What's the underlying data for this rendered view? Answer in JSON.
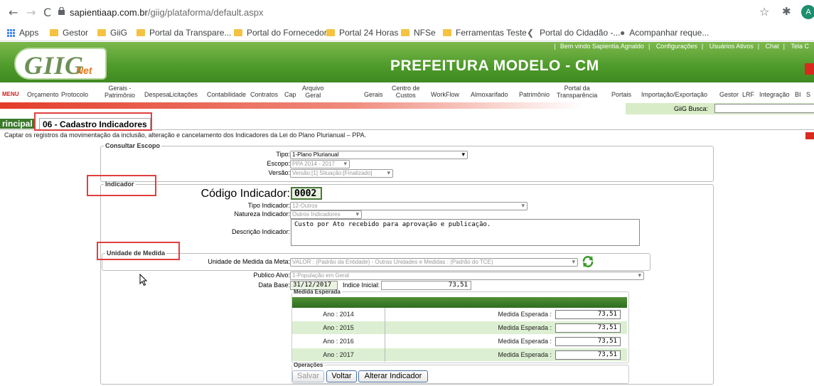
{
  "browser": {
    "url_host": "sapientiaap.com.br",
    "url_path": "/giig/plataforma/default.aspx",
    "avatar_initial": "A",
    "bookmarks": [
      "Apps",
      "Gestor",
      "GiiG",
      "Portal da Transpare...",
      "Portal do Fornecedor",
      "Portal 24 Horas",
      "NFSe",
      "Ferramentas Teste",
      "Portal do Cidadão -...",
      "Acompanhar reque..."
    ]
  },
  "header": {
    "logo_text": "GIIG",
    "logo_sub": "Net",
    "title": "PREFEITURA MODELO - CM",
    "links": [
      "Bem vindo Sapientia.Agnaldo",
      "Configurações",
      "Usuários Ativos",
      "Chat",
      "Tela C"
    ]
  },
  "menu": {
    "label": "MENU",
    "items": [
      "Orçamento",
      "Protocolo",
      "Despesa",
      "Licitações",
      "Contabilidade",
      "Contratos",
      "Cap",
      "Gerais",
      "WorkFlow",
      "Almoxarifado",
      "Patrimônio",
      "Portais",
      "Importação/Exportação",
      "Gestor",
      "LRF",
      "Integração",
      "BI",
      "S"
    ],
    "gerais_patrimonio": [
      "Gerais -",
      "Patrimônio"
    ],
    "arquivo_geral": [
      "Arquivo",
      "Geral"
    ],
    "centro_custos": [
      "Centro de",
      "Custos"
    ],
    "portal_transparencia": [
      "Portal da",
      "Transparência"
    ],
    "busca_label": "GiiG Busca:"
  },
  "tabs": {
    "principal": "rincipal",
    "active": "06 - Cadastro Indicadores"
  },
  "description": "Captar os registros da movimentação da inclusão, alteração e cancelamento dos Indicadores da Lei do Plano Plurianual – PPA.",
  "consultar": {
    "legend": "Consultar Escopo",
    "tipo_label": "Tipo:",
    "tipo_value": "1-Plano Plurianual",
    "escopo_label": "Escopo:",
    "escopo_value": "PPA 2014 - 2017",
    "versao_label": "Versão:",
    "versao_value": "Versão:[1] Situação:[Finalizado]"
  },
  "indicador": {
    "legend": "Indicador",
    "codigo_label": "Código Indicador:",
    "codigo_value": "0002",
    "tipo_label": "Tipo Indicador:",
    "tipo_value": "12-Outros",
    "natureza_label": "Natureza Indicador:",
    "natureza_value": "Outros Indicadores",
    "descricao_label": "Descrição Indicador:",
    "descricao_value": "Custo por Ato recebido para aprovação e publicação."
  },
  "unidade": {
    "legend": "Unidade de Medida",
    "meta_label": "Unidade de Medida da Meta:",
    "meta_value": "VALOR : (Padrão da Entidade) - Outras Unidades e Medidas : (Padrão do TCE)",
    "publico_label": "Publico Alvo:",
    "publico_value": "1-População em Geral",
    "database_label": "Data Base:",
    "database_value": "31/12/2017",
    "indice_label": "Indice Inicial:",
    "indice_value": "73,51"
  },
  "medida": {
    "legend": "Medida Esperada",
    "rows": [
      {
        "ano": "Ano : 2014",
        "label": "Medida Esperada :",
        "value": "73,51"
      },
      {
        "ano": "Ano : 2015",
        "label": "Medida Esperada :",
        "value": "73,51"
      },
      {
        "ano": "Ano : 2016",
        "label": "Medida Esperada :",
        "value": "73,51"
      },
      {
        "ano": "Ano : 2017",
        "label": "Medida Esperada :",
        "value": "73,51"
      }
    ]
  },
  "operacoes": {
    "legend": "Operações",
    "salvar": "Salvar",
    "voltar": "Voltar",
    "alterar": "Alterar Indicador"
  },
  "colors": {
    "header_green": "#4e9a2a",
    "annotation_red": "#e04040",
    "row_green": "#dcefd2"
  }
}
